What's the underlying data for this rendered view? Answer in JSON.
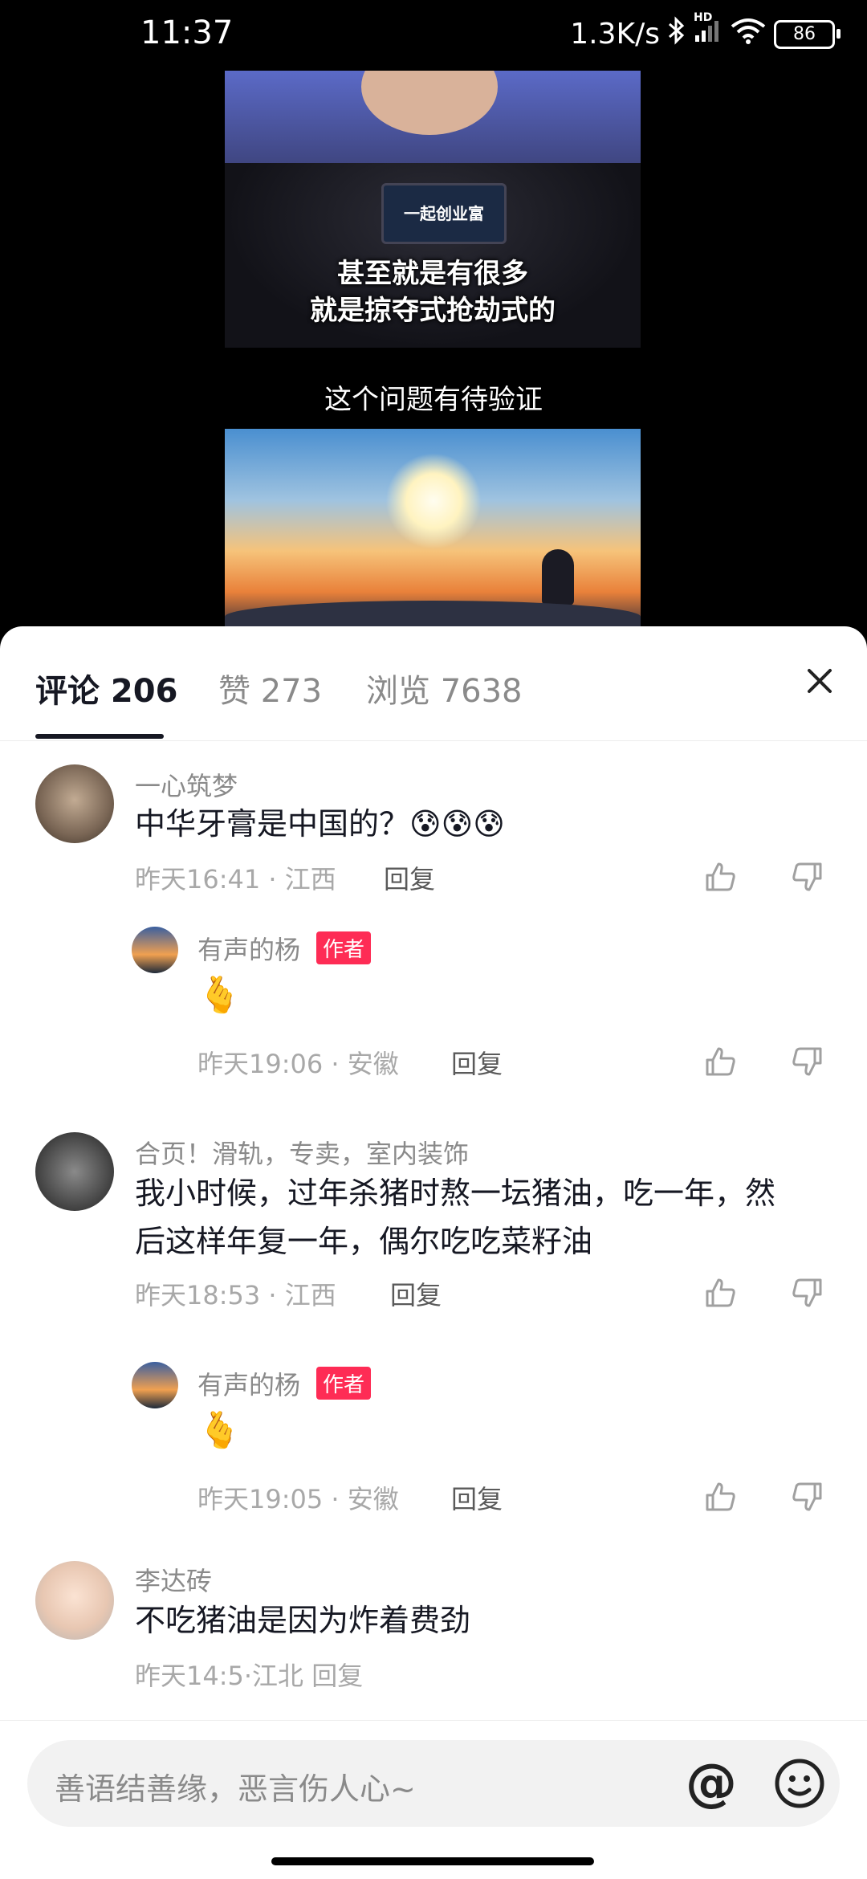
{
  "status_bar": {
    "time": "11:37",
    "network_speed": "1.3K/s",
    "network_type": "HD",
    "battery": "86"
  },
  "video": {
    "caption_line1": "甚至就是有很多",
    "caption_line2": "就是掠夺式抢劫式的",
    "mid_caption": "这个问题有待验证",
    "banner_text": "一起创业富"
  },
  "tabs": [
    {
      "label": "评论 206"
    },
    {
      "label": "赞 273"
    },
    {
      "label": "浏览 7638"
    }
  ],
  "comments": [
    {
      "name": "一心筑梦",
      "text": "中华牙膏是中国的？😰😰😰",
      "time": "昨天16:41 · 江西",
      "reply": "回复"
    },
    {
      "name": "有声的杨",
      "badge": "作者",
      "text": "🫰",
      "time": "昨天19:06 · 安徽",
      "reply": "回复"
    },
    {
      "name": "合页！滑轨，专卖，室内装饰",
      "text_line1": "我小时候，过年杀猪时熬一坛猪油，吃一年，然",
      "text_line2": "后这样年复一年，偶尔吃吃菜籽油",
      "time": "昨天18:53 · 江西",
      "reply": "回复"
    },
    {
      "name": "有声的杨",
      "badge": "作者",
      "text": "🫰",
      "time": "昨天19:05 · 安徽",
      "reply": "回复"
    },
    {
      "name": "李达砖",
      "text": "不吃猪油是因为炸着费劲",
      "time": "昨天14:5·江北 回复"
    }
  ],
  "input": {
    "placeholder": "善语结善缘，恶言伤人心~",
    "at_symbol": "@"
  }
}
